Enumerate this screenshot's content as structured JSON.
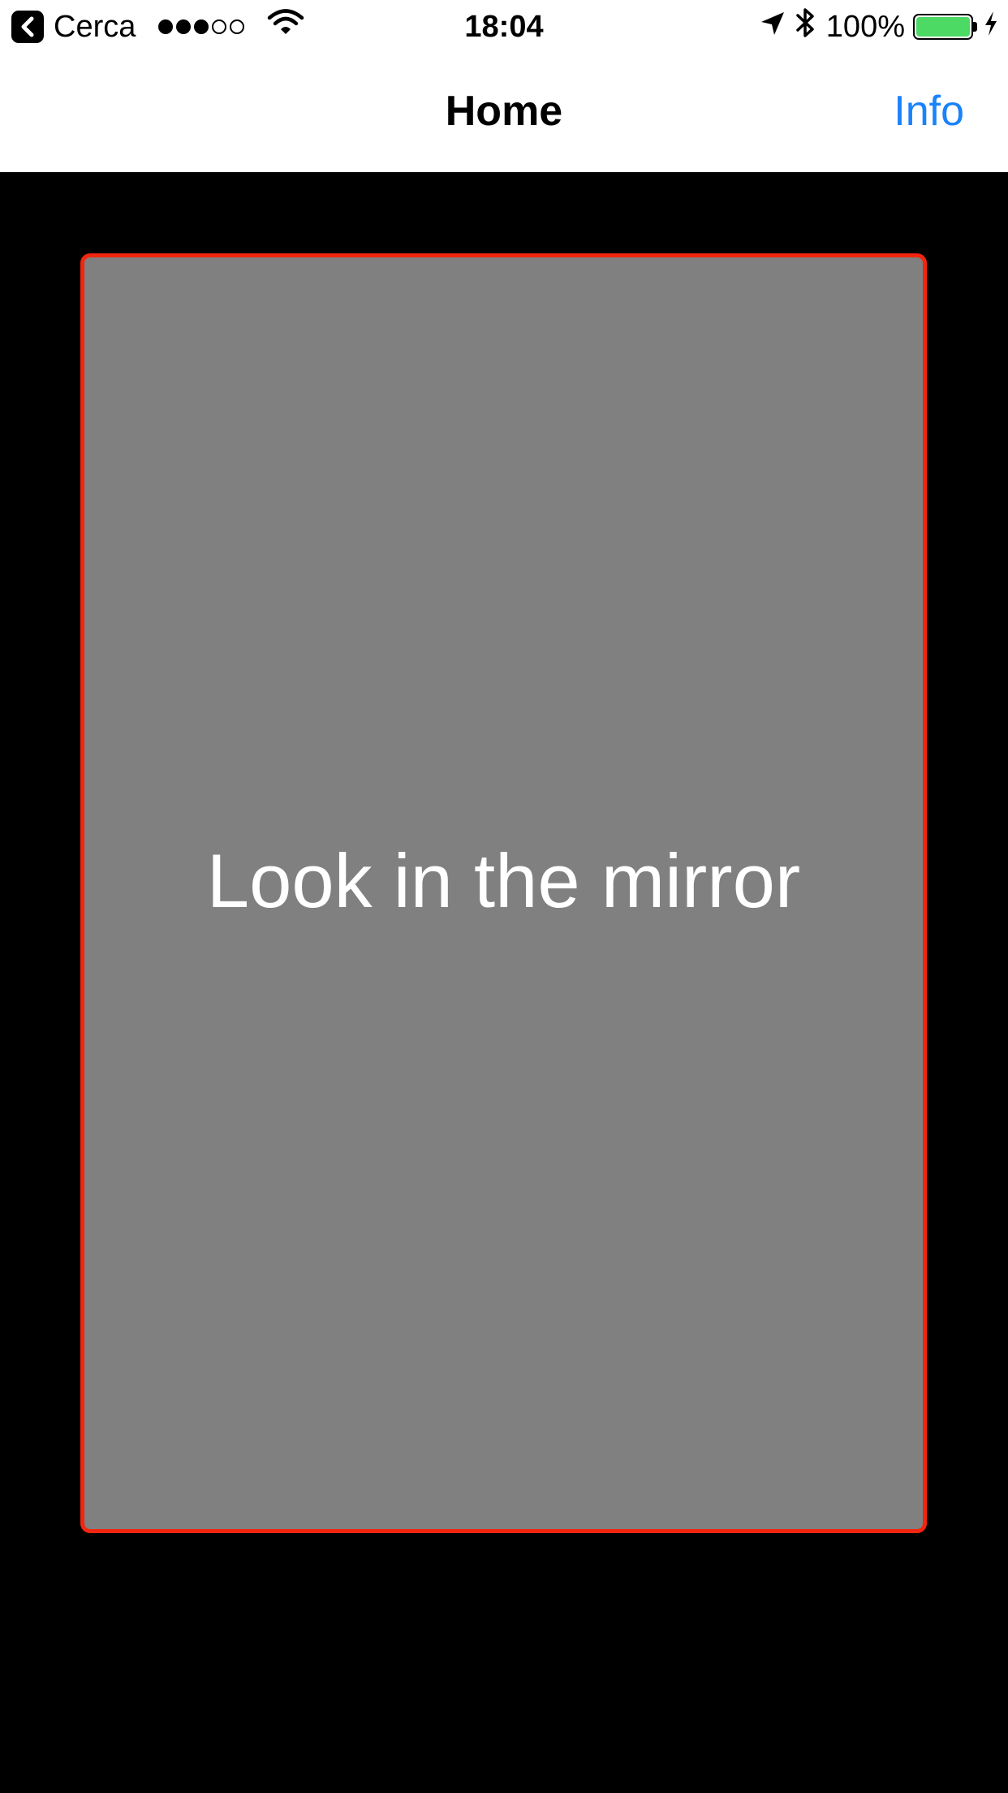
{
  "status_bar": {
    "back_app_label": "Cerca",
    "signal_strength": {
      "filled": 3,
      "total": 5
    },
    "time": "18:04",
    "battery_percent_label": "100%",
    "battery_level": 1.0,
    "icons": [
      "back-app-icon",
      "wifi-icon",
      "location-arrow-icon",
      "bluetooth-icon",
      "battery-icon",
      "charging-bolt-icon"
    ]
  },
  "nav_bar": {
    "title": "Home",
    "right_button": "Info"
  },
  "main": {
    "card_text": "Look in the mirror"
  },
  "colors": {
    "accent": "#1a82fb",
    "card_border": "#f2260f",
    "card_fill": "#808080",
    "background": "#000000",
    "battery": "#4cd964"
  }
}
